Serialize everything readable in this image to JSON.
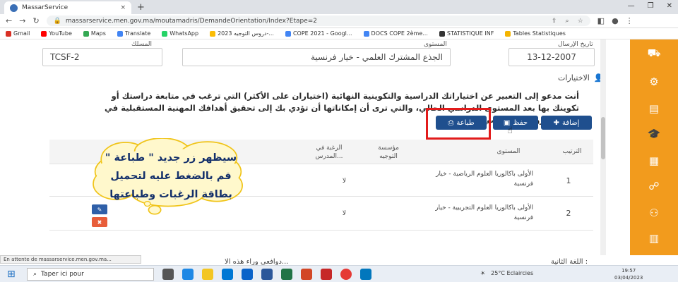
{
  "browser": {
    "tab_title": "MassarService",
    "tab_close": "×",
    "new_tab": "+",
    "url": "massarservice.men.gov.ma/moutamadris/DemandeOrientation/Index?Etape=2",
    "win_controls": [
      "—",
      "❐",
      "✕"
    ]
  },
  "bookmarks": [
    "Gmail",
    "YouTube",
    "Maps",
    "Translate",
    "WhatsApp",
    "دروس التوجيه 2023-...",
    "COPE 2021 - Googl...",
    "DOCS COPE 2ème...",
    "STATISTIQUE INF",
    "Tables Statistiques"
  ],
  "form": {
    "code_label": "المسلك",
    "code_value": "TCSF-2",
    "level_label": "المستوى",
    "level_value": "الجذع المشترك العلمي - خيار فرنسية",
    "date_label": "تاريخ الإرسال",
    "date_value": "13-12-2007"
  },
  "choices": {
    "title": "الاختيارات",
    "paragraph": "أنت مدعو إلى التعبير عن اختياراتك الدراسية والتكوينية النهائية (اختياران على الأكثر) التي ترغب في متابعة دراستك أو تكوينك بها بعد المستوى الدراسي الحالي، والتي ترى أن إمكاناتها أن تؤدي بك إلى تحقيق أهدافك المهنية المستقبلية في إطار مشروعك الشخصي.",
    "add_button": "إضافة",
    "save_button": "حفظ",
    "print_button": "طباعة"
  },
  "table": {
    "headers": {
      "order": "الترتيب",
      "level": "المستوى",
      "institution": "مؤسسة التوجيه",
      "wish": "الرغبة في المدرس..."
    },
    "rows": [
      {
        "order": "1",
        "level": "الأولى باكالوريا العلوم الرياضية - خيار فرنسية",
        "wish": "لا"
      },
      {
        "order": "2",
        "level": "الأولى باكالوريا العلوم التجريبية - خيار فرنسية",
        "wish": "لا"
      }
    ]
  },
  "callout": {
    "line1": "سيظهر زر جديد \" طباعة \"",
    "line2": "قم بالضغط عليه لتحميل",
    "line3": "بطاقة الرغبات وطباعتها"
  },
  "bottom": {
    "second_language": "اللغة الثانية :",
    "motives": "دوافعي وراء هذه الا..."
  },
  "status_text": "En attente de massarservice.men.gov.ma...",
  "taskbar": {
    "search": "Taper ici pour",
    "weather": "25°C  Eclaircies",
    "time": "19:57",
    "date": "03/04/2023"
  },
  "colors": {
    "sidebar": "#f29b1d",
    "primary_button": "#1f4f8e",
    "highlight": "#e21b1b",
    "cloud_fill": "#fff8cc",
    "cloud_stroke": "#f0c419"
  }
}
